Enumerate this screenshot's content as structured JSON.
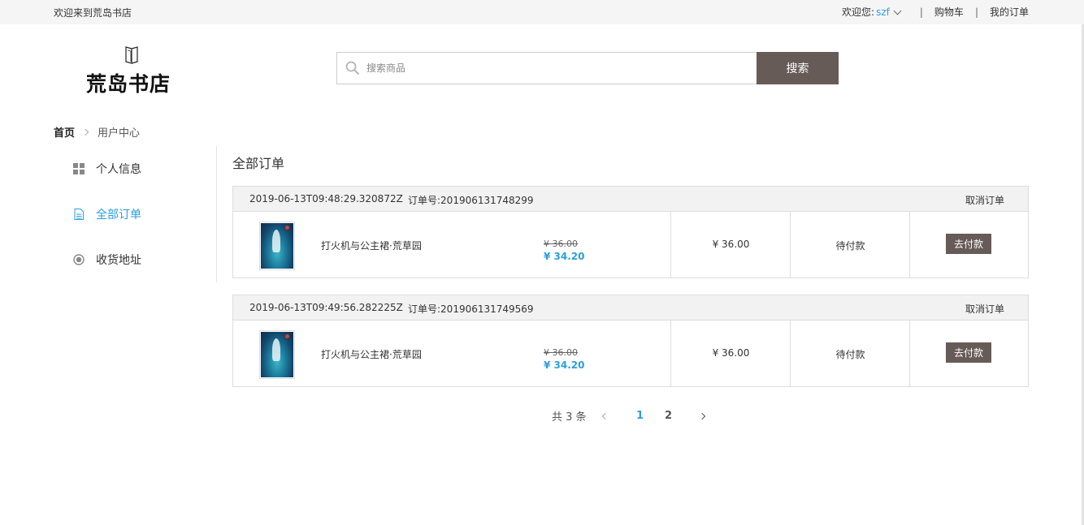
{
  "topbar": {
    "welcome": "欢迎来到荒岛书店",
    "greeting": "欢迎您:",
    "username": "szf",
    "cart": "购物车",
    "sep": "|",
    "my_orders": "我的订单"
  },
  "logo": {
    "text": "荒岛书店"
  },
  "search": {
    "placeholder": "搜索商品",
    "button": "搜索"
  },
  "breadcrumb": {
    "home": "首页",
    "current": "用户中心"
  },
  "sidebar": {
    "items": [
      {
        "label": "个人信息",
        "icon": "grid-icon",
        "active": false
      },
      {
        "label": "全部订单",
        "icon": "document-icon",
        "active": true
      },
      {
        "label": "收货地址",
        "icon": "location-icon",
        "active": false
      }
    ]
  },
  "main": {
    "title": "全部订单",
    "orders": [
      {
        "date": "2019-06-13T09:48:29.320872Z",
        "order_no_label": "订单号:",
        "order_no": "201906131748299",
        "cancel": "取消订单",
        "book_title": "打火机与公主裙·荒草园",
        "price_old": "¥ 36.00",
        "price_new": "¥ 34.20",
        "total": "¥ 36.00",
        "status": "待付款",
        "pay": "去付款"
      },
      {
        "date": "2019-06-13T09:49:56.282225Z",
        "order_no_label": "订单号:",
        "order_no": "201906131749569",
        "cancel": "取消订单",
        "book_title": "打火机与公主裙·荒草园",
        "price_old": "¥ 36.00",
        "price_new": "¥ 34.20",
        "total": "¥ 36.00",
        "status": "待付款",
        "pay": "去付款"
      }
    ]
  },
  "pagination": {
    "total": "共 3 条",
    "pages": [
      "1",
      "2"
    ],
    "current": "1"
  },
  "colors": {
    "accent": "#2a9ee0",
    "button": "#675b58"
  }
}
